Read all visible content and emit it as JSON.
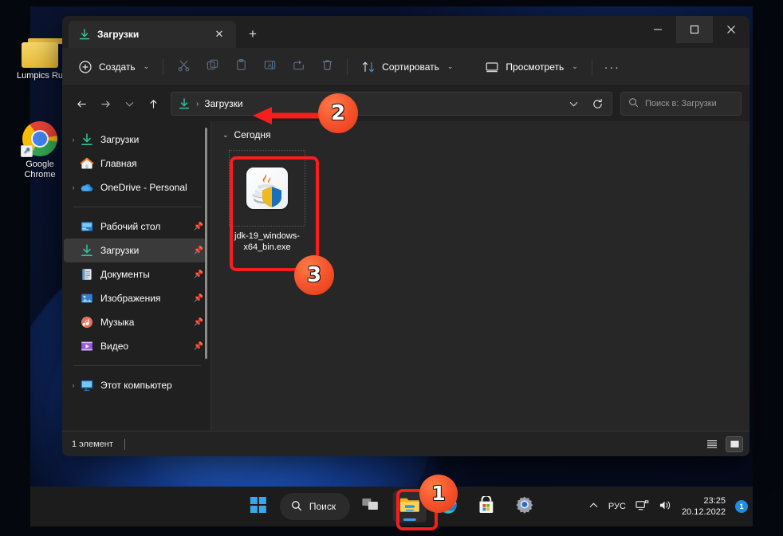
{
  "desktop": {
    "icons": [
      {
        "name": "Lumpics Ru",
        "icon": "folder-icon"
      },
      {
        "name": "Google\nChrome",
        "label_line1": "Google",
        "label_line2": "Chrome",
        "icon": "chrome-icon"
      }
    ]
  },
  "explorer": {
    "tab": {
      "title": "Загрузки",
      "icon": "downloads-icon",
      "close_label": "✕",
      "new_tab_label": "+"
    },
    "window_controls": {
      "minimize": "minimize-icon",
      "maximize": "maximize-icon",
      "close": "close-icon"
    },
    "toolbar": {
      "new_label": "Создать",
      "cut_label": "Вырезать",
      "copy_label": "Копировать",
      "paste_label": "Вставить",
      "rename_label": "Переименовать",
      "share_label": "Поделиться",
      "delete_label": "Удалить",
      "sort_label": "Сортировать",
      "view_label": "Просмотреть",
      "more_label": "···"
    },
    "address": {
      "back_label": "←",
      "forward_label": "→",
      "recent_label": "⌄",
      "up_label": "↑",
      "crumb_icon": "downloads-icon",
      "crumb_sep": "›",
      "crumb_text": "Загрузки",
      "dropdown_label": "⌄",
      "refresh_label": "⟳",
      "search_placeholder": "Поиск в: Загрузки"
    },
    "nav": {
      "items": [
        {
          "label": "Загрузки",
          "icon": "downloads-icon",
          "expandable": true,
          "pinned": false,
          "selected": false
        },
        {
          "label": "Главная",
          "icon": "home-icon",
          "expandable": false,
          "pinned": false,
          "selected": false
        },
        {
          "label": "OneDrive - Personal",
          "icon": "onedrive-icon",
          "expandable": true,
          "pinned": false,
          "selected": false
        },
        {
          "divider": true
        },
        {
          "label": "Рабочий стол",
          "icon": "desktop-icon",
          "expandable": false,
          "pinned": true,
          "selected": false
        },
        {
          "label": "Загрузки",
          "icon": "downloads-icon",
          "expandable": false,
          "pinned": true,
          "selected": true
        },
        {
          "label": "Документы",
          "icon": "documents-icon",
          "expandable": false,
          "pinned": true,
          "selected": false
        },
        {
          "label": "Изображения",
          "icon": "pictures-icon",
          "expandable": false,
          "pinned": true,
          "selected": false
        },
        {
          "label": "Музыка",
          "icon": "music-icon",
          "expandable": false,
          "pinned": true,
          "selected": false
        },
        {
          "label": "Видео",
          "icon": "video-icon",
          "expandable": false,
          "pinned": true,
          "selected": false
        },
        {
          "divider": true
        },
        {
          "label": "Этот компьютер",
          "icon": "this-pc-icon",
          "expandable": true,
          "pinned": false,
          "selected": false
        }
      ]
    },
    "content": {
      "group_header": "Сегодня",
      "group_chevron": "⌄",
      "files": [
        {
          "name": "jdk-19_windows-x64_bin.exe",
          "icon": "java-installer-icon"
        }
      ]
    },
    "status": {
      "item_count": "1 элемент",
      "view_list_label": "Список",
      "view_tiles_label": "Крупные значки"
    }
  },
  "taskbar": {
    "start_label": "Пуск",
    "search_label": "Поиск",
    "items": [
      {
        "name": "task-view",
        "icon": "task-view-icon"
      },
      {
        "name": "file-explorer",
        "icon": "file-explorer-icon",
        "active": true
      },
      {
        "name": "microsoft-edge",
        "icon": "edge-icon"
      },
      {
        "name": "microsoft-store",
        "icon": "store-icon"
      },
      {
        "name": "settings",
        "icon": "settings-icon"
      }
    ],
    "tray": {
      "expand_label": "⌃",
      "language": "РУС",
      "network_icon": "network-icon",
      "volume_icon": "volume-icon",
      "time": "23:25",
      "date": "20.12.2022",
      "notification_count": "1"
    }
  },
  "annotations": {
    "badges": [
      {
        "number": "1",
        "target": "file-explorer-taskbar-button"
      },
      {
        "number": "2",
        "target": "address-bar-breadcrumb"
      },
      {
        "number": "3",
        "target": "jdk-installer-file"
      }
    ],
    "highlight_color": "#f61e1e"
  }
}
